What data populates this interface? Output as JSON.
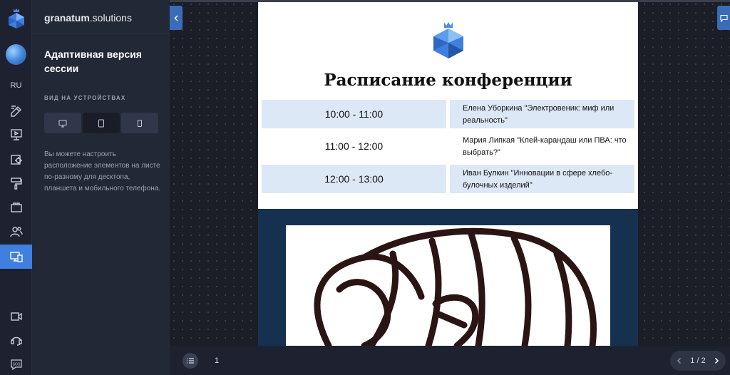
{
  "app": {
    "brand_bold": "granatum",
    "brand_rest": ".solutions"
  },
  "rail": {
    "lang": "RU",
    "items": [
      {
        "icon": "edit-icon"
      },
      {
        "icon": "presentation-icon"
      },
      {
        "icon": "settings-icon"
      },
      {
        "icon": "paint-roller-icon"
      },
      {
        "icon": "module-icon"
      },
      {
        "icon": "users-icon"
      },
      {
        "icon": "devices-icon",
        "active": true
      },
      {
        "icon": "video-icon"
      },
      {
        "icon": "support-icon"
      },
      {
        "icon": "sos-icon"
      }
    ]
  },
  "panel": {
    "title": "Адаптивная версия сессии",
    "section_label": "ВИД НА УСТРОЙСТВАХ",
    "devices": [
      {
        "icon": "desktop-icon"
      },
      {
        "icon": "tablet-icon",
        "active": true
      },
      {
        "icon": "mobile-icon"
      }
    ],
    "description": "Вы можете настроить расположение элементов на листе по-разному для десктопа, планшета и мобильного телефона."
  },
  "page": {
    "heading": "Расписание конференции",
    "schedule": [
      {
        "time": "10:00 - 11:00",
        "talk": "Елена Уборкина \"Электровеник: миф или реальность\""
      },
      {
        "time": "11:00 - 12:00",
        "talk": "Мария Липкая \"Клей-карандаш или ПВА: что выбрать?\""
      },
      {
        "time": "12:00 - 13:00",
        "talk": "Иван Булкин \"Инновации в сфере хлебо-булочных изделий\""
      }
    ]
  },
  "bottombar": {
    "page_number": "1",
    "pager_indicator": "1 / 2"
  },
  "colors": {
    "accent": "#3f7fe0",
    "rail_bg": "#1e2230",
    "panel_bg": "#232836",
    "page_dark": "#163050",
    "row_shade": "#dde8f6"
  }
}
